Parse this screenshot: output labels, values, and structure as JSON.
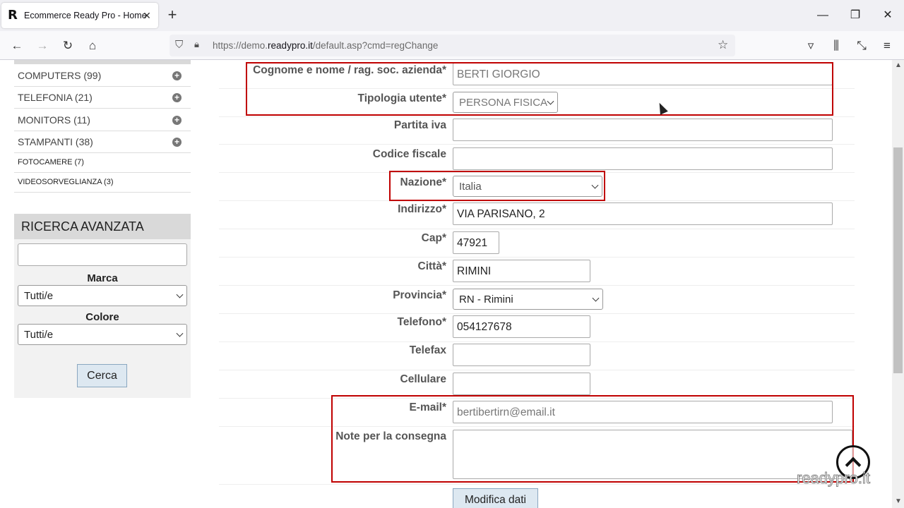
{
  "browser": {
    "tab_title": "Ecommerce Ready Pro - Home",
    "favicon_letter": "R",
    "url_prefix": "https://demo.",
    "url_domain": "readypro.it",
    "url_path": "/default.asp?cmd=regChange"
  },
  "sidebar": {
    "categories": [
      {
        "label": "COMPUTERS (99)",
        "expandable": true
      },
      {
        "label": "TELEFONIA (21)",
        "expandable": true
      },
      {
        "label": "MONITORS (11)",
        "expandable": true
      },
      {
        "label": "STAMPANTI (38)",
        "expandable": true
      },
      {
        "label": "FOTOCAMERE (7)",
        "expandable": false
      },
      {
        "label": "VIDEOSORVEGLIANZA (3)",
        "expandable": false
      }
    ],
    "advanced_search": {
      "title": "RICERCA AVANZATA",
      "search_value": "",
      "brand_label": "Marca",
      "brand_value": "Tutti/e",
      "color_label": "Colore",
      "color_value": "Tutti/e",
      "search_button": "Cerca"
    }
  },
  "form": {
    "name_label": "Cognome e nome / rag. soc. azienda*",
    "name_value": "BERTI GIORGIO",
    "user_type_label": "Tipologia utente*",
    "user_type_value": "PERSONA FISICA",
    "vat_label": "Partita iva",
    "vat_value": "",
    "tax_code_label": "Codice fiscale",
    "tax_code_value": "",
    "country_label": "Nazione*",
    "country_value": "Italia",
    "address_label": "Indirizzo*",
    "address_value": "VIA PARISANO, 2",
    "zip_label": "Cap*",
    "zip_value": "47921",
    "city_label": "Città*",
    "city_value": "RIMINI",
    "province_label": "Provincia*",
    "province_value": "RN - Rimini",
    "phone_label": "Telefono*",
    "phone_value": "054127678",
    "fax_label": "Telefax",
    "fax_value": "",
    "mobile_label": "Cellulare",
    "mobile_value": "",
    "email_label": "E-mail*",
    "email_value": "bertibertirn@email.it",
    "notes_label": "Note per la consegna",
    "notes_value": "",
    "submit_label": "Modifica dati"
  },
  "watermark": "readypro.it",
  "colors": {
    "highlight": "#c00000",
    "button_bg": "#dde8f1"
  }
}
